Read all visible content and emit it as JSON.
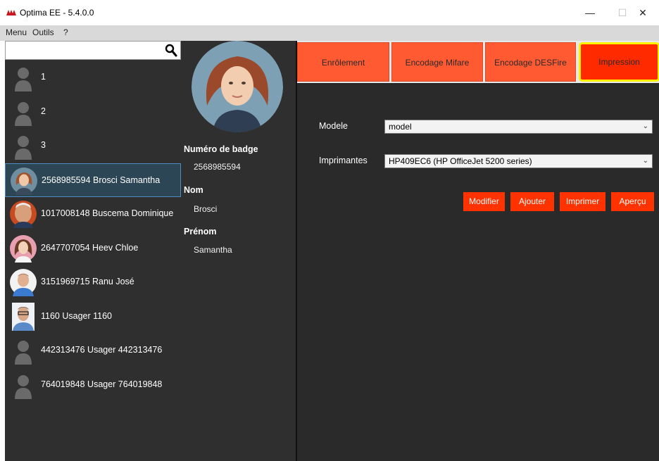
{
  "window": {
    "title": "Optima EE - 5.4.0.0",
    "minimize": "—",
    "maximize": "☐",
    "close": "✕"
  },
  "menu": {
    "items": [
      "Menu",
      "Outils",
      "?"
    ]
  },
  "search": {
    "value": "",
    "placeholder": ""
  },
  "users": [
    {
      "label": "1",
      "avatar": "person-silhouette-icon"
    },
    {
      "label": "2",
      "avatar": "person-silhouette-icon"
    },
    {
      "label": "3",
      "avatar": "person-silhouette-icon"
    },
    {
      "label": "2568985594  Brosci  Samantha",
      "avatar": "user-photo",
      "selected": true
    },
    {
      "label": "1017008148  Buscema  Dominique",
      "avatar": "user-photo"
    },
    {
      "label": "2647707054  Heev  Chloe",
      "avatar": "user-photo"
    },
    {
      "label": "3151969715  Ranu  José",
      "avatar": "user-photo"
    },
    {
      "label": "1160  Usager  1160",
      "avatar": "user-photo"
    },
    {
      "label": "442313476  Usager  442313476",
      "avatar": "person-silhouette-icon"
    },
    {
      "label": "764019848  Usager  764019848",
      "avatar": "person-silhouette-icon"
    }
  ],
  "detail": {
    "badge_title": "Numéro de badge",
    "badge_value": "2568985594",
    "nom_title": "Nom",
    "nom_value": "Brosci",
    "prenom_title": "Prénom",
    "prenom_value": "Samantha"
  },
  "tabs": [
    {
      "label": "Enrôlement"
    },
    {
      "label": "Encodage Mifare"
    },
    {
      "label": "Encodage DESFire"
    },
    {
      "label": "Impression",
      "active": true
    }
  ],
  "impression": {
    "modele_label": "Modele",
    "modele_value": "model",
    "imprimantes_label": "Imprimantes",
    "imprimantes_value": "HP409EC6 (HP OfficeJet 5200 series)",
    "buttons": {
      "modifier": "Modifier",
      "ajouter": "Ajouter",
      "imprimer": "Imprimer",
      "apercu": "Aperçu"
    }
  },
  "colors": {
    "accent": "#ff3200",
    "tab": "#ff5a32",
    "active_highlight": "#fff200",
    "panel": "#2f2f2f",
    "selection": "#2d4656"
  }
}
